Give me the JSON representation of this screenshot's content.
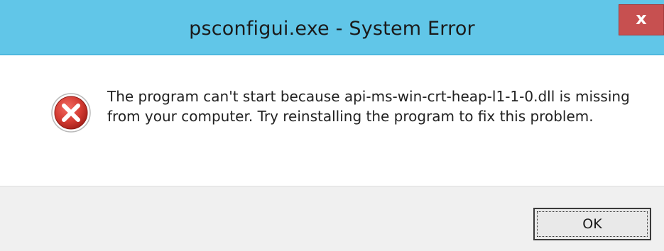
{
  "window": {
    "title": "psconfigui.exe - System Error",
    "close_glyph": "x",
    "close_icon": "close-icon",
    "accent_color": "#61c6e8",
    "close_color": "#c75050"
  },
  "message": {
    "icon": "error-icon",
    "icon_color": "#c9302c",
    "text": "The program can't start because api-ms-win-crt-heap-l1-1-0.dll is missing from your computer. Try reinstalling the program to fix this problem."
  },
  "buttons": {
    "ok_label": "OK"
  }
}
